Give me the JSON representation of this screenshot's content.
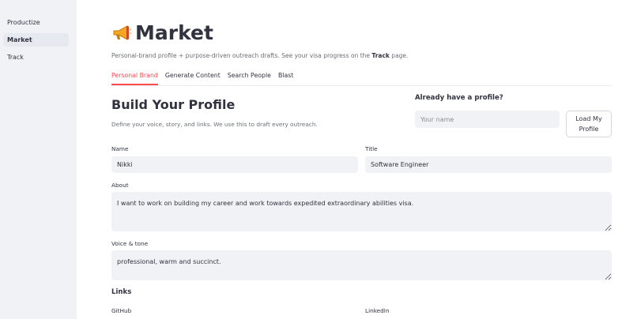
{
  "sidebar": {
    "items": [
      {
        "label": "Productize"
      },
      {
        "label": "Market"
      },
      {
        "label": "Track"
      }
    ]
  },
  "page": {
    "title": "Market",
    "title_icon": "megaphone-icon",
    "subtitle_pre": "Personal-brand profile + purpose-driven outreach drafts. See your visa progress on the ",
    "subtitle_link": "Track",
    "subtitle_post": " page."
  },
  "tabs": [
    {
      "label": "Personal Brand"
    },
    {
      "label": "Generate Content"
    },
    {
      "label": "Search People"
    },
    {
      "label": "Blast"
    }
  ],
  "build": {
    "title": "Build Your Profile",
    "description": "Define your voice, story, and links. We use this to draft every outreach."
  },
  "load_profile": {
    "question": "Already have a profile?",
    "name_placeholder": "Your name",
    "button_label": "Load My Profile"
  },
  "form": {
    "name_label": "Name",
    "name_value": "Nikki",
    "title_label": "Title",
    "title_value": "Software Engineer",
    "about_label": "About",
    "about_value": "I want to work on building my career and work towards expedited extraordinary abilities visa.",
    "voice_label": "Voice & tone",
    "voice_value": "professional, warm and succinct.",
    "links_title": "Links",
    "github_label": "GitHub",
    "linkedin_label": "LinkedIn"
  },
  "colors": {
    "accent": "#ff4b4b",
    "sidebar_bg": "#f0f2f6",
    "input_bg": "#f0f2f6",
    "text": "#31333f"
  }
}
